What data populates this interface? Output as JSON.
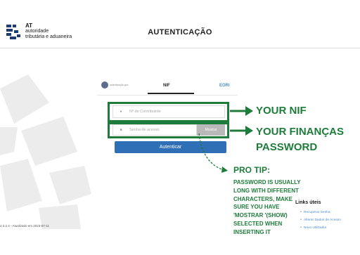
{
  "header": {
    "brand_line1": "AT",
    "brand_line2": "autoridade",
    "brand_line3": "tributária e aduaneira",
    "page_title": "AUTENTICAÇÃO"
  },
  "tabs": {
    "autenticacao_label": "autenticação.gov",
    "nif_label": "NIF",
    "eori_label": "EORI"
  },
  "form": {
    "nif_placeholder": "Nº de Contribuinte",
    "password_placeholder": "Senha de acesso",
    "show_password_label": "Mostrar",
    "submit_label": "Autenticar"
  },
  "annotations": {
    "your_nif": "YOUR NIF",
    "your_password_line1": "YOUR FINANÇAS",
    "your_password_line2": "PASSWORD",
    "pro_tip_title": "PRO TIP:",
    "pro_tip_lines": [
      "PASSWORD IS USUALLY",
      "LONG WITH DIFFERENT",
      "CHARACTERS, MAKE",
      "SURE YOU HAVE",
      "'MOSTRAR '(SHOW)",
      "SELECTED WHEN",
      "INSERTING IT"
    ]
  },
  "links": {
    "title": "Links úteis",
    "items": [
      "Recuperar Senha",
      "Alterar Dados de Acesso",
      "Novo Utilizador"
    ]
  },
  "footer": {
    "version": "o 2.2.4 - Atualizado em 2023-07-11"
  },
  "colors": {
    "annotation_green": "#1e7c3a",
    "primary_blue": "#2f6fb6",
    "link_blue": "#4a8cc7"
  }
}
